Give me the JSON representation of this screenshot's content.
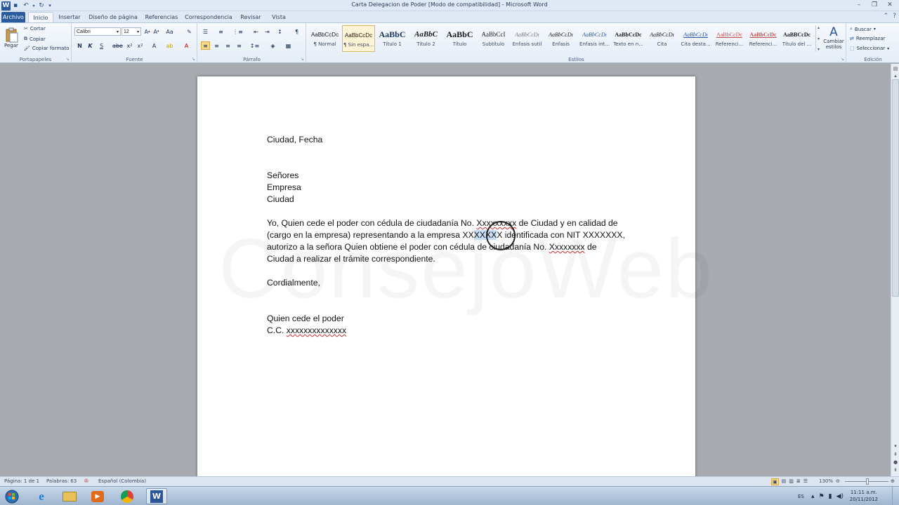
{
  "window": {
    "title": "Carta Delegacion de Poder [Modo de compatibilidad]  -  Microsoft Word",
    "app_icon": "W"
  },
  "tabs": [
    "Archivo",
    "Inicio",
    "Insertar",
    "Diseño de página",
    "Referencias",
    "Correspondencia",
    "Revisar",
    "Vista"
  ],
  "ribbon": {
    "clipboard": {
      "paste": "Pegar",
      "cut": "Cortar",
      "copy": "Copiar",
      "format_painter": "Copiar formato",
      "label": "Portapapeles"
    },
    "font": {
      "name": "Calibri",
      "size": "12",
      "label": "Fuente"
    },
    "paragraph": {
      "label": "Párrafo"
    },
    "styles": {
      "label": "Estilos",
      "items": [
        {
          "sample": "AaBbCcDc",
          "name": "¶ Normal"
        },
        {
          "sample": "AaBbCcDc",
          "name": "¶ Sin espa..."
        },
        {
          "sample": "AaBbC",
          "name": "Título 1"
        },
        {
          "sample": "AaBbC",
          "name": "Título 2"
        },
        {
          "sample": "AaBbC",
          "name": "Título"
        },
        {
          "sample": "AaBbCcI",
          "name": "Subtítulo"
        },
        {
          "sample": "AaBbCcDı",
          "name": "Énfasis sutil"
        },
        {
          "sample": "AaBbCcDı",
          "name": "Énfasis"
        },
        {
          "sample": "AaBbCcDı",
          "name": "Énfasis int..."
        },
        {
          "sample": "AaBbCcDc",
          "name": "Texto en n..."
        },
        {
          "sample": "AaBbCcDı",
          "name": "Cita"
        },
        {
          "sample": "AaBbCcDı",
          "name": "Cita desta..."
        },
        {
          "sample": "AaBbCcDc",
          "name": "Referenci..."
        },
        {
          "sample": "AaBbCcDc",
          "name": "Referenci..."
        },
        {
          "sample": "AaBBCcDc",
          "name": "Título del ..."
        }
      ],
      "change_styles": "Cambiar estilos"
    },
    "editing": {
      "label": "Edición",
      "find": "Buscar",
      "replace": "Reemplazar",
      "select": "Seleccionar"
    }
  },
  "document": {
    "line1": "Ciudad, Fecha",
    "addr1": "Señores",
    "addr2": "Empresa",
    "addr3": "Ciudad",
    "p1_l1_a": "Yo, Quien cede el poder con cédula de ciudadanía No. ",
    "p1_l1_b": "Xxxxxxxxx",
    "p1_l1_c": " de Ciudad y en calidad de",
    "p1_l2_a": "(cargo en la empresa) representando a la empresa ",
    "p1_l2_b": "XX",
    "p1_l2_c": "XXXX",
    "p1_l2_d": "X identificada con NIT XXXXXXX,",
    "p1_l3_a": "autorizo a la señora Quien obtiene el poder con cédula de ciudadanía No. ",
    "p1_l3_b": "Xxxxxxxx",
    "p1_l3_c": " de",
    "p1_l4": "Ciudad a realizar el trámite correspondiente.",
    "closing": "Cordialmente,",
    "sig1": "Quien cede el poder",
    "sig2_a": "C.C. ",
    "sig2_b": "xxxxxxxxxxxxxx",
    "watermark": "ConsejoWeb"
  },
  "status": {
    "page": "Página: 1 de 1",
    "words": "Palabras: 63",
    "language": "Español (Colombia)",
    "zoom": "130%"
  },
  "taskbar": {
    "lang": "ES",
    "time": "11:11 a.m.",
    "date": "20/11/2012"
  }
}
